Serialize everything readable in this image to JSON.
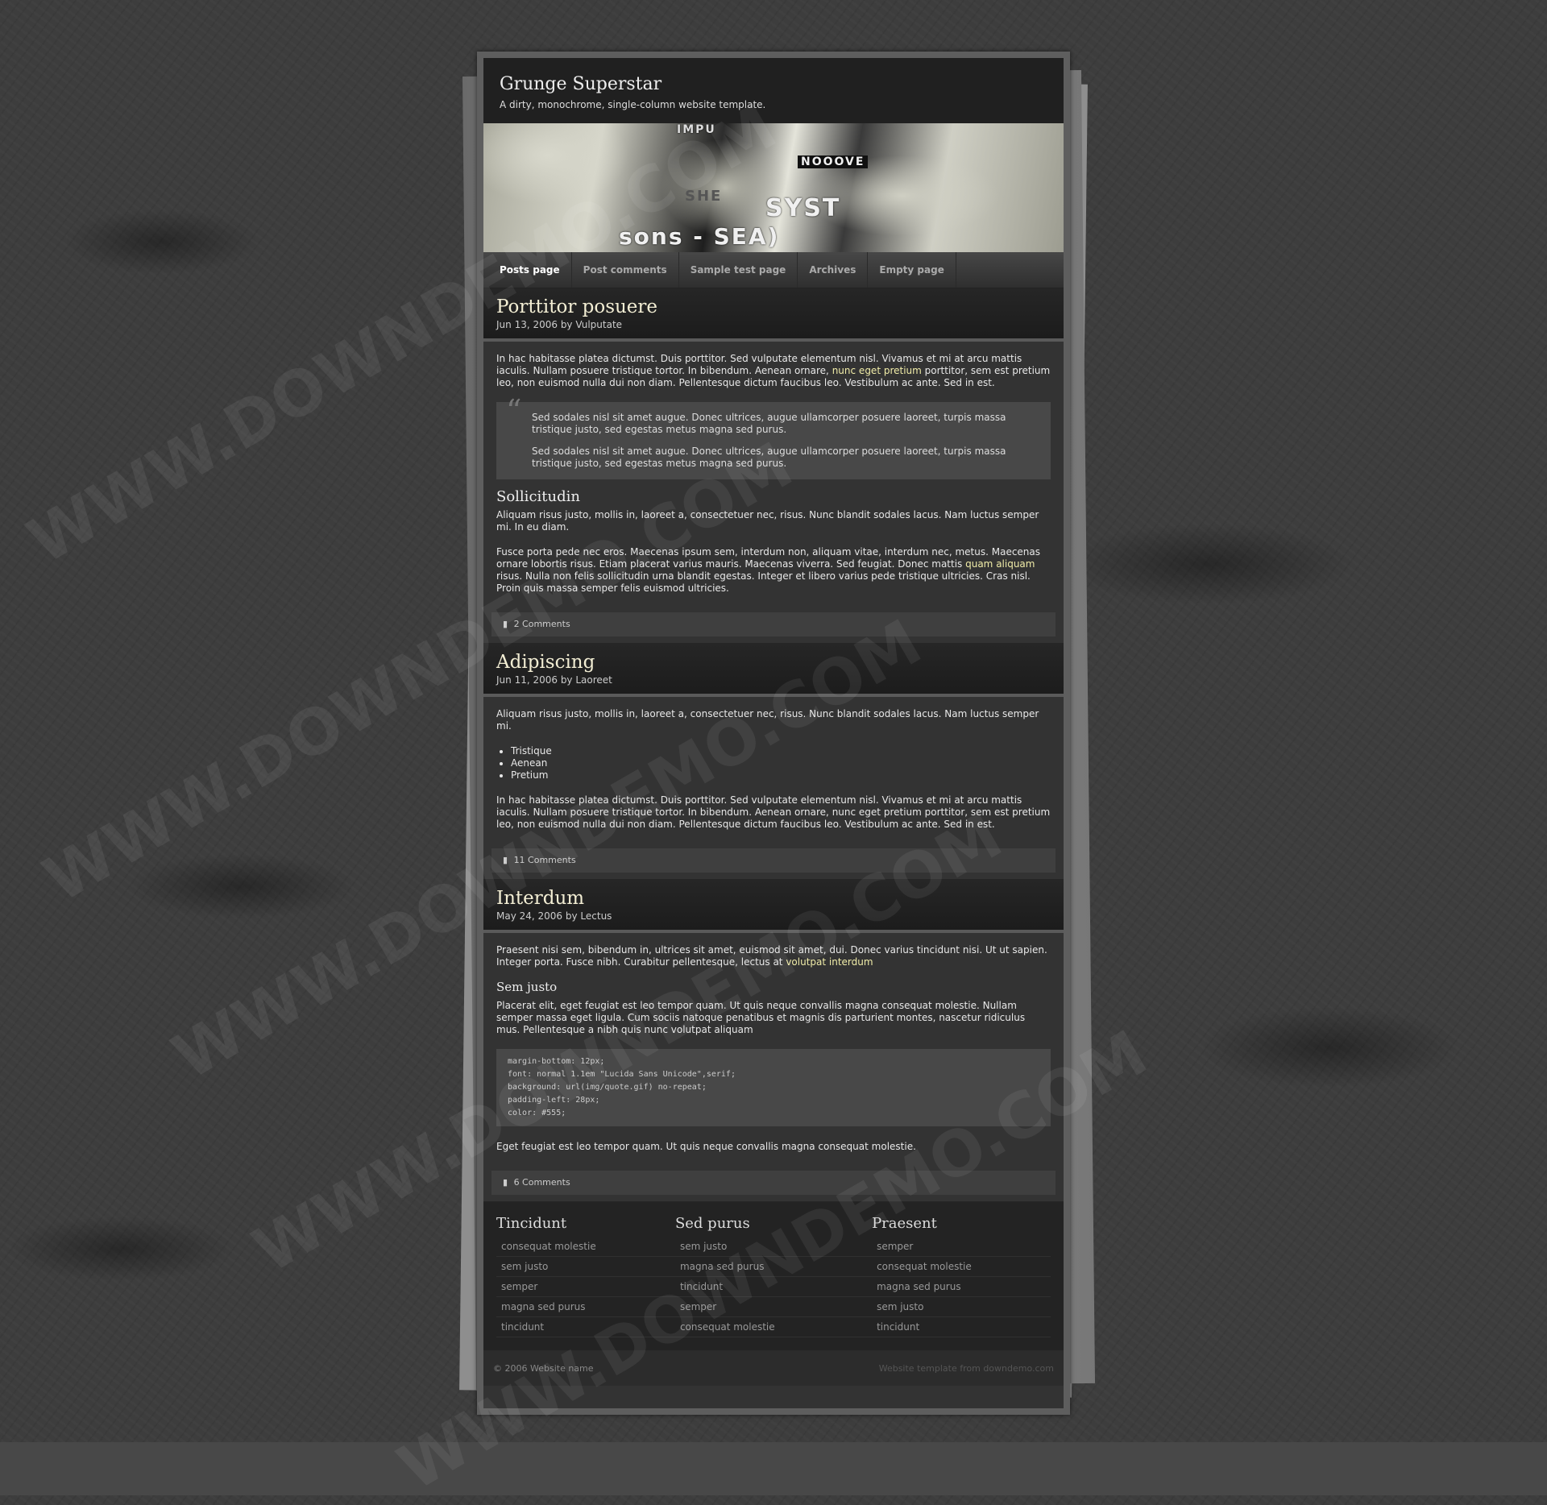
{
  "site": {
    "title": "Grunge Superstar",
    "tagline": "A dirty, monochrome, single-column website template."
  },
  "banner": {
    "texts": [
      "IMPU",
      "NOOOVE",
      "SYST",
      "sons - SEA)",
      "SHE"
    ]
  },
  "nav": [
    {
      "label": "Posts page",
      "active": true
    },
    {
      "label": "Post comments",
      "active": false
    },
    {
      "label": "Sample test page",
      "active": false
    },
    {
      "label": "Archives",
      "active": false
    },
    {
      "label": "Empty page",
      "active": false
    }
  ],
  "posts": [
    {
      "title": "Porttitor posuere",
      "meta": "Jun 13, 2006 by Vulputate",
      "p1_a": "In hac habitasse platea dictumst. Duis porttitor. Sed vulputate elementum nisl. Vivamus et mi at arcu mattis iaculis. Nullam posuere tristique tortor. In bibendum. Aenean ornare, ",
      "p1_link": "nunc eget pretium",
      "p1_b": " porttitor, sem est pretium leo, non euismod nulla dui non diam. Pellentesque dictum faucibus leo. Vestibulum ac ante. Sed in est.",
      "quote_mark": "“",
      "quote1": "Sed sodales nisl sit amet augue. Donec ultrices, augue ullamcorper posuere laoreet, turpis massa tristique justo, sed egestas metus magna sed purus.",
      "quote2": "Sed sodales nisl sit amet augue. Donec ultrices, augue ullamcorper posuere laoreet, turpis massa tristique justo, sed egestas metus magna sed purus.",
      "subhead": "Sollicitudin",
      "p2": "Aliquam risus justo, mollis in, laoreet a, consectetuer nec, risus. Nunc blandit sodales lacus. Nam luctus semper mi. In eu diam.",
      "p3_a": "Fusce porta pede nec eros. Maecenas ipsum sem, interdum non, aliquam vitae, interdum nec, metus. Maecenas ornare lobortis risus. Etiam placerat varius mauris. Maecenas viverra. Sed feugiat. Donec mattis ",
      "p3_link": "quam aliquam",
      "p3_b": " risus. Nulla non felis sollicitudin urna blandit egestas. Integer et libero varius pede tristique ultricies. Cras nisl. Proin quis massa semper felis euismod ultricies.",
      "comments": "2 Comments"
    },
    {
      "title": "Adipiscing",
      "meta": "Jun 11, 2006 by Laoreet",
      "p1": "Aliquam risus justo, mollis in, laoreet a, consectetuer nec, risus. Nunc blandit sodales lacus. Nam luctus semper mi.",
      "list": [
        "Tristique",
        "Aenean",
        "Pretium"
      ],
      "p2": "In hac habitasse platea dictumst. Duis porttitor. Sed vulputate elementum nisl. Vivamus et mi at arcu mattis iaculis. Nullam posuere tristique tortor. In bibendum. Aenean ornare, nunc eget pretium porttitor, sem est pretium leo, non euismod nulla dui non diam. Pellentesque dictum faucibus leo. Vestibulum ac ante. Sed in est.",
      "comments": "11 Comments"
    },
    {
      "title": "Interdum",
      "meta": "May 24, 2006 by Lectus",
      "p1_a": "Praesent nisi sem, bibendum in, ultrices sit amet, euismod sit amet, dui. Donec varius tincidunt nisi. Ut ut sapien. Integer porta. Fusce nibh. Curabitur pellentesque, lectus at ",
      "p1_link": "volutpat interdum",
      "subhead": "Sem justo",
      "p2": "Placerat elit, eget feugiat est leo tempor quam. Ut quis neque convallis magna consequat molestie. Nullam semper massa eget ligula. Cum sociis natoque penatibus et magnis dis parturient montes, nascetur ridiculus mus. Pellentesque a nibh quis nunc volutpat aliquam",
      "code": "margin-bottom: 12px;\nfont: normal 1.1em \"Lucida Sans Unicode\",serif;\nbackground: url(img/quote.gif) no-repeat;\npadding-left: 28px;\ncolor: #555;",
      "p3": "Eget feugiat est leo tempor quam. Ut quis neque convallis magna consequat molestie.",
      "comments": "6 Comments"
    }
  ],
  "footer_columns": [
    {
      "title": "Tincidunt",
      "links": [
        "consequat molestie",
        "sem justo",
        "semper",
        "magna sed purus",
        "tincidunt"
      ]
    },
    {
      "title": "Sed purus",
      "links": [
        "sem justo",
        "magna sed purus",
        "tincidunt",
        "semper",
        "consequat molestie"
      ]
    },
    {
      "title": "Praesent",
      "links": [
        "semper",
        "consequat molestie",
        "magna sed purus",
        "sem justo",
        "tincidunt"
      ]
    }
  ],
  "footer": {
    "copyright": "© 2006 Website name",
    "credit": "Website template from downdemo.com"
  },
  "watermark": "WWW.DOWNDEMO.COM",
  "colors": {
    "background": "#3d3d3d",
    "panel": "#333333",
    "link_accent": "#f0eca8",
    "title_accent": "#f3eed4"
  }
}
